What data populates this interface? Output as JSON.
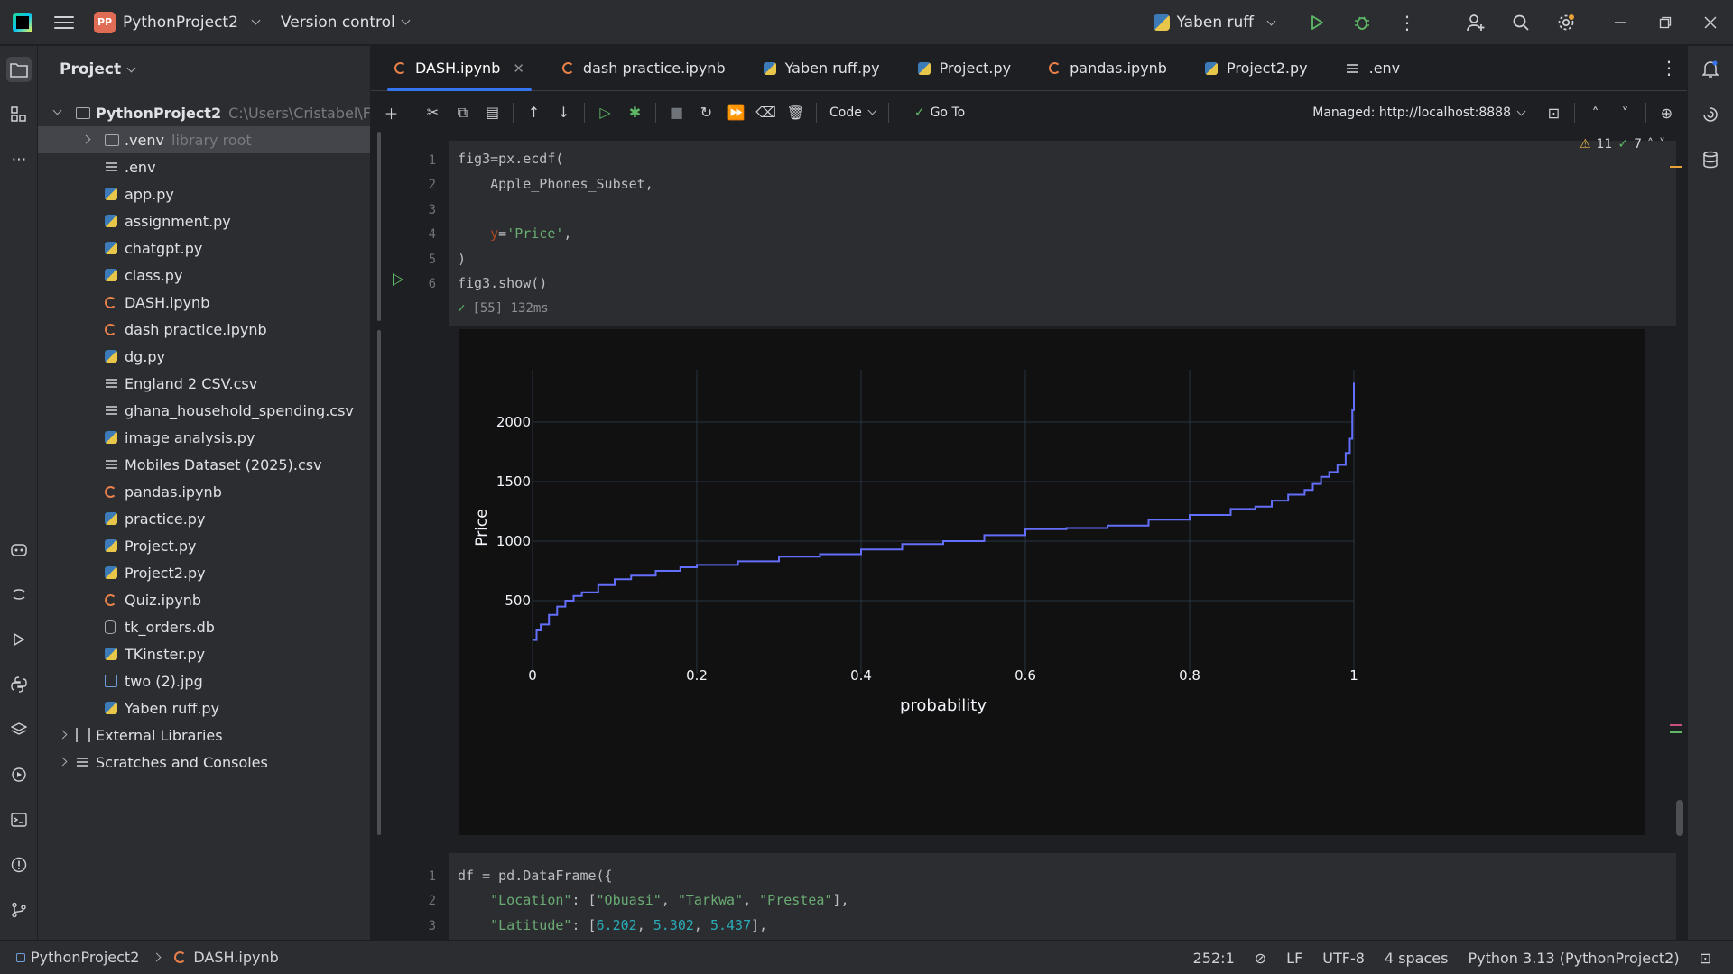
{
  "titlebar": {
    "project_badge": "PP",
    "project_name": "PythonProject2",
    "version_control": "Version control",
    "run_config": "Yaben ruff"
  },
  "project_panel": {
    "title": "Project",
    "root": {
      "name": "PythonProject2",
      "path": "C:\\Users\\Cristabel\\F"
    },
    "venv": {
      "name": ".venv",
      "note": "library root"
    },
    "files": [
      {
        "name": ".env",
        "icon": "text-file-icon"
      },
      {
        "name": "app.py",
        "icon": "python-file-icon"
      },
      {
        "name": "assignment.py",
        "icon": "python-file-icon"
      },
      {
        "name": "chatgpt.py",
        "icon": "python-file-icon"
      },
      {
        "name": "class.py",
        "icon": "python-file-icon"
      },
      {
        "name": "DASH.ipynb",
        "icon": "notebook-file-icon"
      },
      {
        "name": "dash practice.ipynb",
        "icon": "notebook-file-icon"
      },
      {
        "name": "dg.py",
        "icon": "python-file-icon"
      },
      {
        "name": "England 2 CSV.csv",
        "icon": "text-file-icon"
      },
      {
        "name": "ghana_household_spending.csv",
        "icon": "text-file-icon"
      },
      {
        "name": "image analysis.py",
        "icon": "python-file-icon"
      },
      {
        "name": "Mobiles Dataset (2025).csv",
        "icon": "text-file-icon"
      },
      {
        "name": "pandas.ipynb",
        "icon": "notebook-file-icon"
      },
      {
        "name": "practice.py",
        "icon": "python-file-icon"
      },
      {
        "name": "Project.py",
        "icon": "python-file-icon"
      },
      {
        "name": "Project2.py",
        "icon": "python-file-icon"
      },
      {
        "name": "Quiz.ipynb",
        "icon": "notebook-file-icon"
      },
      {
        "name": "tk_orders.db",
        "icon": "database-file-icon"
      },
      {
        "name": "TKinster.py",
        "icon": "python-file-icon"
      },
      {
        "name": "two (2).jpg",
        "icon": "image-file-icon"
      },
      {
        "name": "Yaben ruff.py",
        "icon": "python-file-icon"
      }
    ],
    "external_libraries": "External Libraries",
    "scratches": "Scratches and Consoles"
  },
  "tabs": [
    {
      "label": "DASH.ipynb",
      "active": true
    },
    {
      "label": "dash practice.ipynb"
    },
    {
      "label": "Yaben ruff.py"
    },
    {
      "label": "Project.py"
    },
    {
      "label": "pandas.ipynb"
    },
    {
      "label": "Project2.py"
    },
    {
      "label": ".env"
    }
  ],
  "notebook_toolbar": {
    "cell_type": "Code",
    "goto": "Go To",
    "managed": "Managed: http://localhost:8888"
  },
  "inspections": {
    "warnings": "11",
    "ok": "7"
  },
  "cell1": {
    "line_numbers": [
      "1",
      "2",
      "3",
      "4",
      "5",
      "6"
    ],
    "lines": {
      "l1": "fig3=px.ecdf(",
      "l2": "    Apple_Phones_Subset,",
      "l4_param": "y",
      "l4_eq": "=",
      "l4_str": "'Price'",
      "l4_end": ",",
      "l5": ")",
      "l6": "fig3.show()"
    },
    "exec_status": "[55] 132ms"
  },
  "cell2": {
    "line_numbers": [
      "1",
      "2",
      "3"
    ],
    "l1": "df = pd.DataFrame({",
    "l2_key": "\"Location\"",
    "l2_colon": ": [",
    "l2_v1": "\"Obuasi\"",
    "l2_v2": "\"Tarkwa\"",
    "l2_v3": "\"Prestea\"",
    "l2_end": "],",
    "l3_key": "\"Latitude\"",
    "l3_colon": ": [",
    "l3_v1": "6.202",
    "l3_v2": "5.302",
    "l3_v3": "5.437",
    "l3_end": "],",
    "sep": ", "
  },
  "chart_data": {
    "type": "line",
    "subtype": "ecdf",
    "xlabel": "probability",
    "ylabel": "Price",
    "xlim": [
      0,
      1
    ],
    "ylim": [
      150,
      2400
    ],
    "xticks": [
      "0",
      "0.2",
      "0.4",
      "0.6",
      "0.8",
      "1"
    ],
    "yticks": [
      "500",
      "1000",
      "1500",
      "2000"
    ],
    "grid": true,
    "line_color": "#636efa",
    "series": [
      {
        "x": [
          0.0,
          0.005,
          0.01,
          0.02,
          0.03,
          0.04,
          0.05,
          0.06,
          0.08,
          0.1,
          0.12,
          0.15,
          0.18,
          0.2,
          0.25,
          0.3,
          0.35,
          0.4,
          0.45,
          0.5,
          0.55,
          0.6,
          0.65,
          0.7,
          0.75,
          0.8,
          0.85,
          0.88,
          0.9,
          0.92,
          0.94,
          0.95,
          0.96,
          0.97,
          0.98,
          0.99,
          0.995,
          0.998,
          1.0
        ],
        "y": [
          170,
          250,
          300,
          380,
          450,
          500,
          540,
          570,
          630,
          680,
          710,
          750,
          780,
          800,
          830,
          870,
          890,
          930,
          975,
          1000,
          1050,
          1100,
          1110,
          1130,
          1180,
          1220,
          1270,
          1290,
          1340,
          1390,
          1430,
          1480,
          1540,
          1580,
          1640,
          1740,
          1860,
          2100,
          2330
        ]
      }
    ]
  }
}
